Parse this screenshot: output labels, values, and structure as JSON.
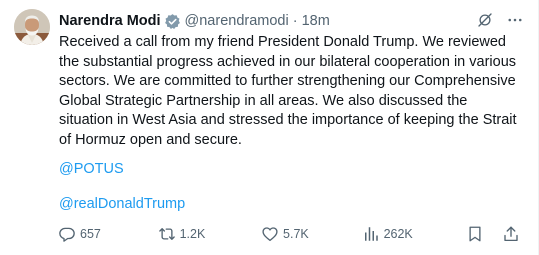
{
  "author": {
    "name": "Narendra Modi",
    "handle": "@narendramodi",
    "separator": "·",
    "time": "18m"
  },
  "tweet": {
    "text": "Received a call from my friend President Donald Trump. We reviewed the substantial progress achieved in our bilateral cooperation in various sectors. We are committed to further strengthening our Comprehensive Global Strategic Partnership in all areas. We also discussed the situation in West Asia and stressed the importance of keeping the Strait of Hormuz open and secure.",
    "mentions": [
      "@POTUS",
      "@realDonaldTrump"
    ]
  },
  "actions": {
    "replies": "657",
    "reposts": "1.2K",
    "likes": "5.7K",
    "views": "262K"
  },
  "colors": {
    "text": "#0f1419",
    "secondary": "#536471",
    "link": "#1d9bf0",
    "verified": "#829aab"
  },
  "icons": {
    "verified": "verified-badge-icon",
    "grok": "grok-icon",
    "more": "more-dots-icon",
    "reply": "reply-icon",
    "repost": "repost-icon",
    "like": "heart-icon",
    "views": "views-chart-icon",
    "bookmark": "bookmark-icon",
    "share": "share-icon"
  }
}
